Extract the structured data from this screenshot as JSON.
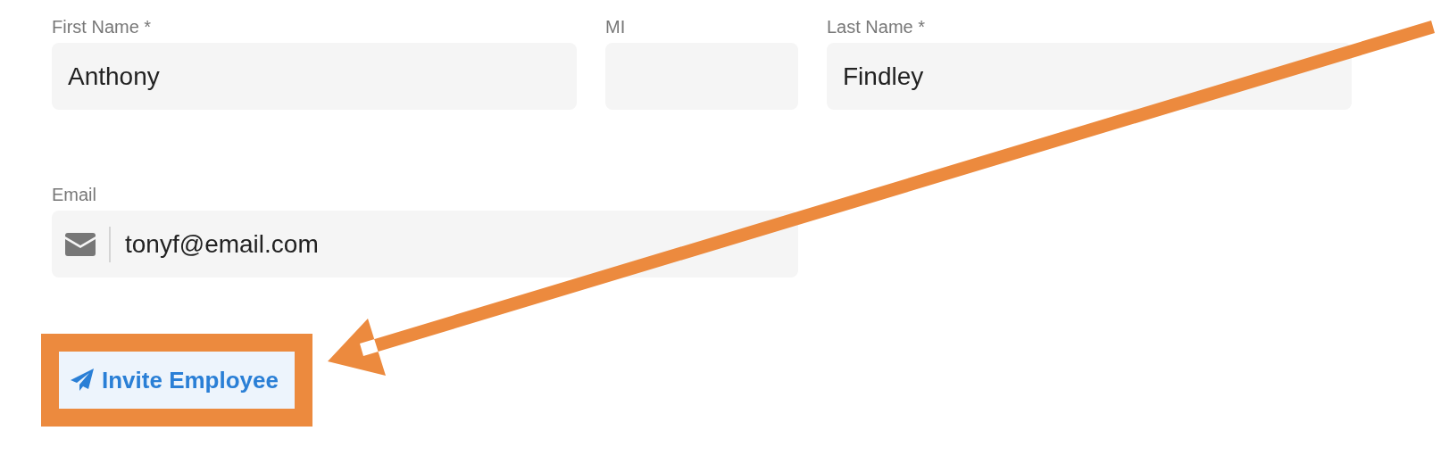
{
  "name_fields": [
    {
      "label": "First Name *",
      "value": "Anthony"
    },
    {
      "label": "MI"
    },
    {
      "label": "Last Name *",
      "value": "Findley"
    }
  ],
  "email": {
    "label": "Email",
    "value": "tonyf@email.com"
  },
  "button": {
    "label": "Invite Employee"
  }
}
